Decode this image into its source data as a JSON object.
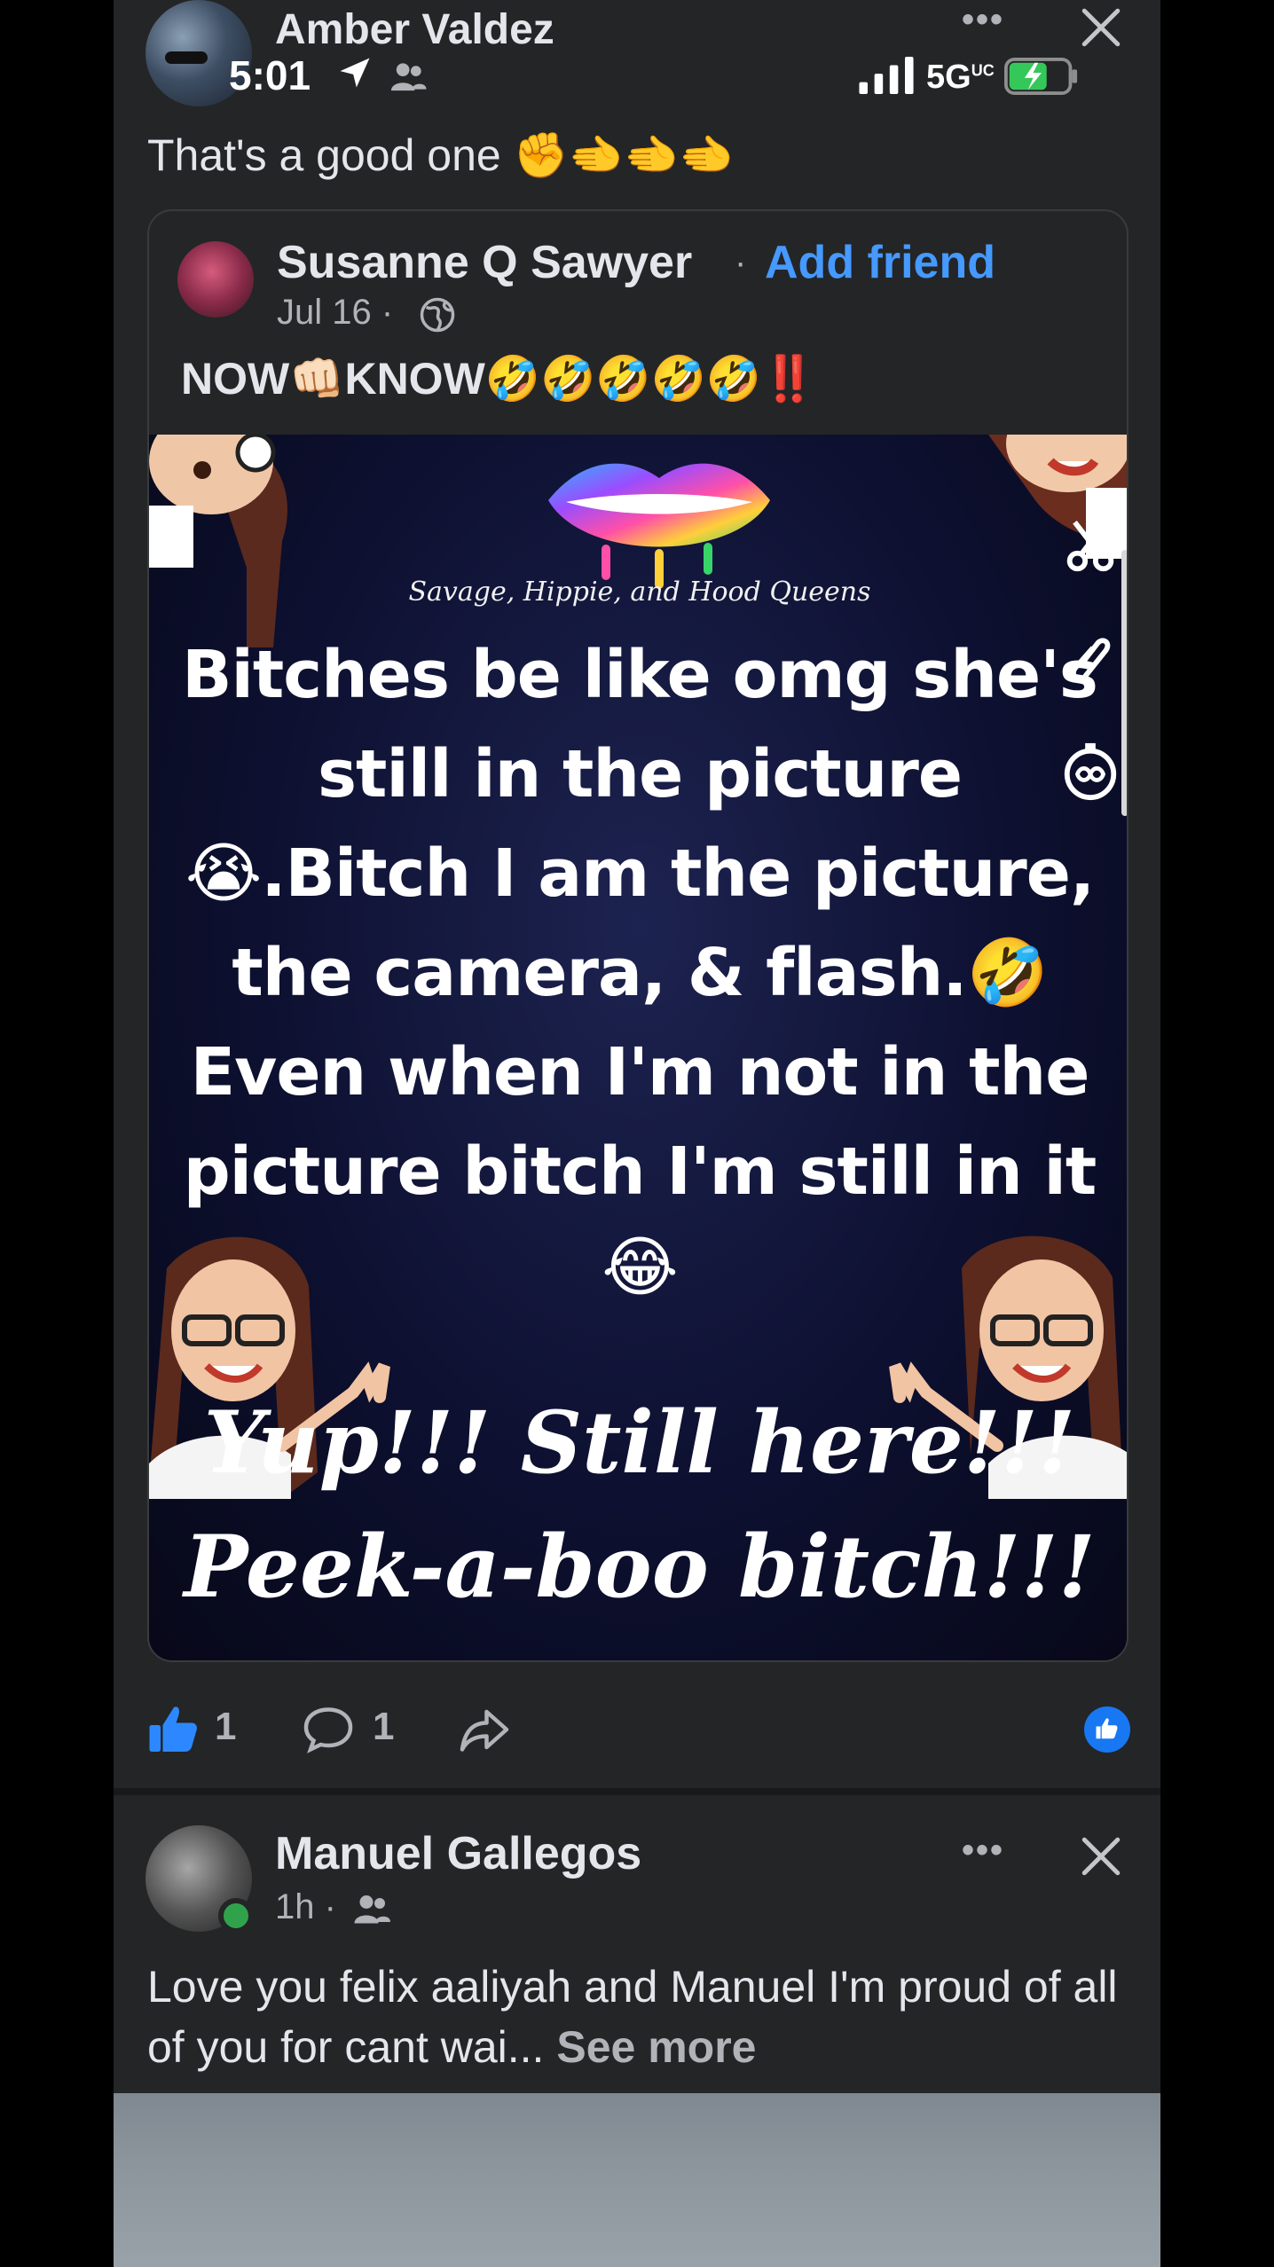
{
  "status_bar": {
    "time": "5:01",
    "network": "5G",
    "network_sup": "UC"
  },
  "post1": {
    "author": "Amber Valdez",
    "caption": "That's a good one",
    "caption_emoji": "✊🫲🫲🫲",
    "shared": {
      "author": "Susanne Q Sawyer",
      "separator": "·",
      "add_friend": "Add friend",
      "date": "Jul 16 ·",
      "caption_a": "NOW",
      "caption_emoji_a": "👊🏻",
      "caption_b": "KNOW",
      "caption_emoji_b": "🤣🤣🤣🤣🤣",
      "caption_bangs": "‼️",
      "meme": {
        "brand": "Savage, Hippie, and Hood Queens",
        "line1": "Bitches be like omg she's",
        "line2": "still in the picture",
        "line3_emoji": "😭",
        "line3": ".Bitch I am the picture,",
        "line4": "the camera, & flash.",
        "line4_emoji": "🤣",
        "line5": "Even when I'm not in the",
        "line6": "picture bitch I'm still in it",
        "line7_emoji": "😂",
        "script1": "Yup!!! Still here!!!",
        "script2": "Peek-a-boo bitch!!!"
      }
    },
    "likes": "1",
    "comments": "1"
  },
  "post2": {
    "author": "Manuel Gallegos",
    "time": "1h ·",
    "text": "Love you felix aaliyah and Manuel I'm proud of all of you for cant wai...",
    "see_more": "See more"
  },
  "colors": {
    "background": "#242526",
    "link_blue": "#4599ff",
    "online_green": "#31a24c",
    "like_blue": "#1877f2"
  },
  "icons": [
    "more-dots-icon",
    "close-icon",
    "globe-icon",
    "friends-icon",
    "like-icon",
    "comment-icon",
    "share-icon",
    "location-arrow-icon",
    "signal-icon",
    "battery-icon",
    "scissors-icon",
    "paperclip-icon",
    "timer-icon"
  ]
}
